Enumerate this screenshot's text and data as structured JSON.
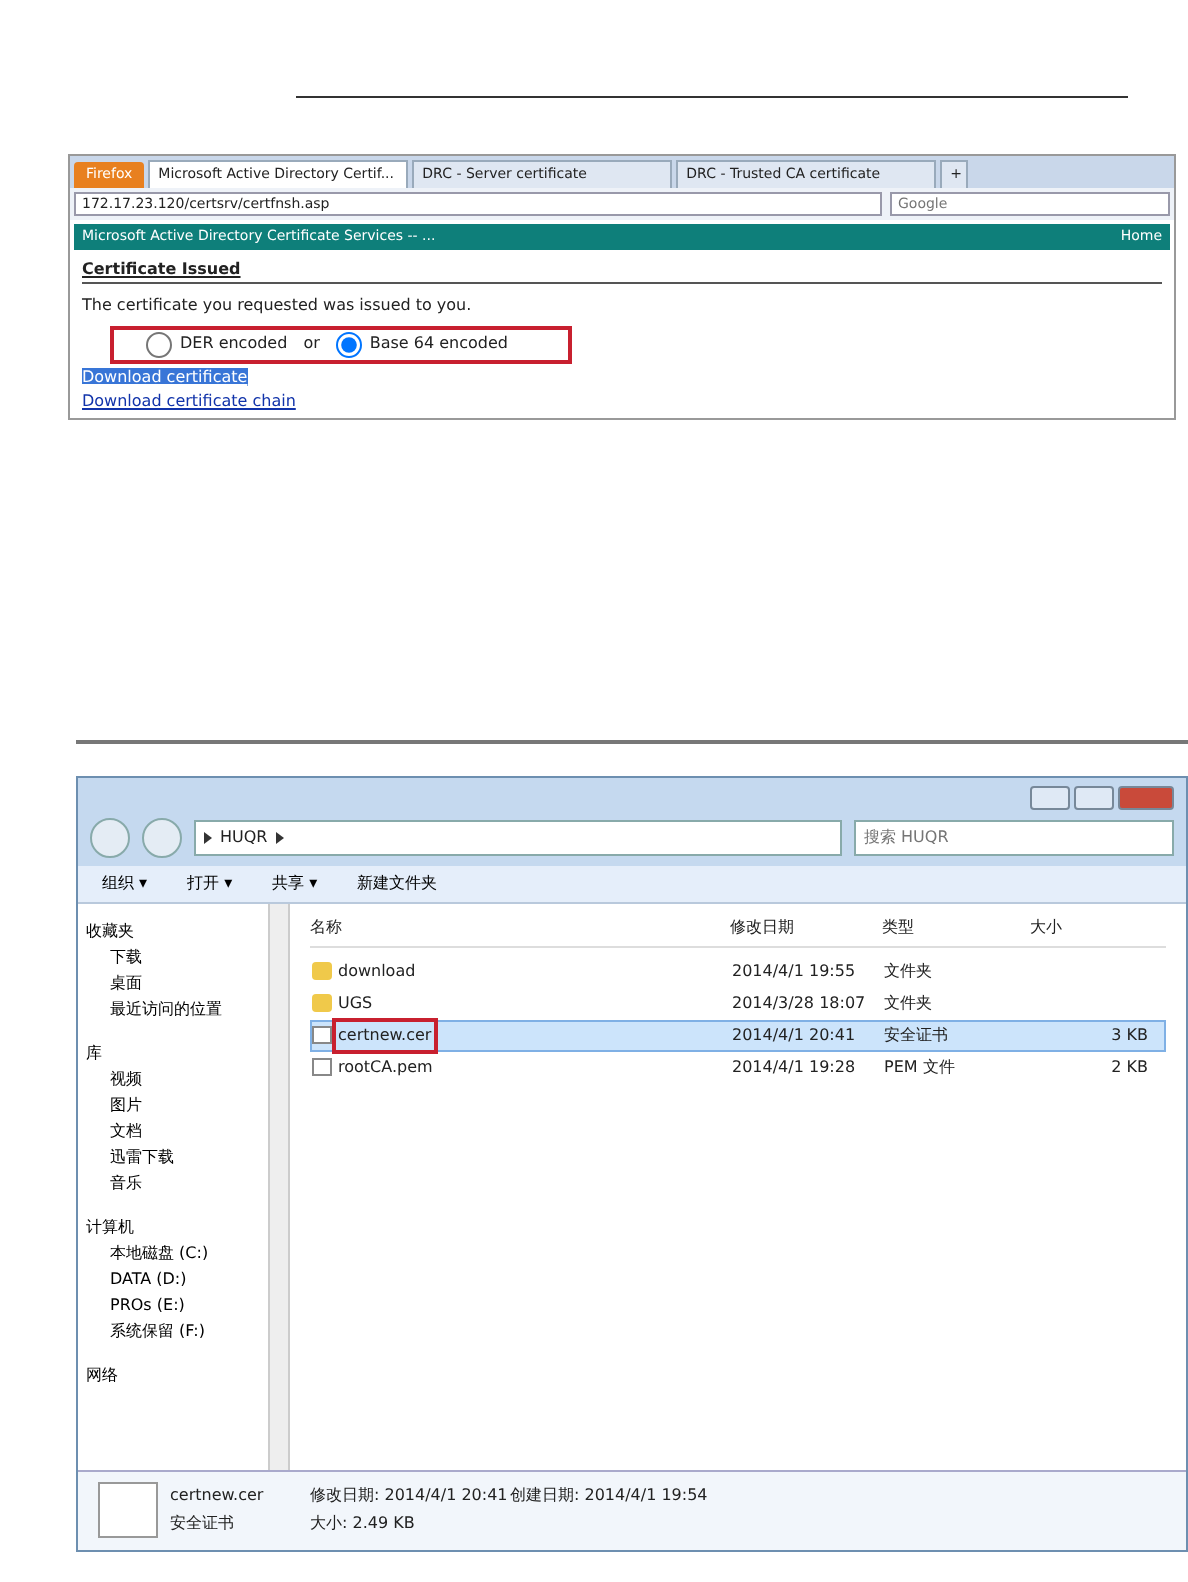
{
  "browser": {
    "menu_button": "Firefox",
    "tabs": [
      {
        "label": "Microsoft Active Directory Certif...",
        "selected": true
      },
      {
        "label": "DRC - Server certificate",
        "selected": false
      },
      {
        "label": "DRC - Trusted CA certificate",
        "selected": false
      }
    ],
    "new_tab": "+",
    "address": "172.17.23.120/certsrv/certfnsh.asp",
    "search_placeholder": "Google",
    "header": {
      "title": "Microsoft Active Directory Certificate Services -- ...",
      "home": "Home"
    },
    "heading": "Certificate Issued",
    "message": "The certificate you requested was issued to you.",
    "encodings": [
      {
        "label": "DER encoded",
        "selected": false
      },
      {
        "label": "Base 64 encoded",
        "selected": true
      }
    ],
    "encoding_separator": "or",
    "links": [
      "Download certificate",
      "Download certificate chain"
    ]
  },
  "explorer": {
    "path": "HUQR",
    "search_placeholder": "搜索 HUQR",
    "toolbar": [
      "组织 ▾",
      "打开 ▾",
      "共享 ▾",
      "新建文件夹"
    ],
    "sidebar": [
      {
        "label": "收藏夹",
        "children": [
          {
            "label": "下载"
          },
          {
            "label": "桌面"
          },
          {
            "label": "最近访问的位置"
          }
        ]
      },
      {
        "label": "库",
        "children": [
          {
            "label": "视频"
          },
          {
            "label": "图片"
          },
          {
            "label": "文档"
          },
          {
            "label": "迅雷下载"
          },
          {
            "label": "音乐"
          }
        ]
      },
      {
        "label": "计算机",
        "children": [
          {
            "label": "本地磁盘 (C:)"
          },
          {
            "label": "DATA (D:)"
          },
          {
            "label": "PROs (E:)"
          },
          {
            "label": "系统保留 (F:)"
          }
        ]
      },
      {
        "label": "网络"
      }
    ],
    "columns": [
      "名称",
      "修改日期",
      "类型",
      "大小"
    ],
    "rows": [
      {
        "kind": "folder",
        "name": "download",
        "date": "2014/4/1 19:55",
        "type": "文件夹",
        "selected": false
      },
      {
        "kind": "folder",
        "name": "UGS",
        "date": "2014/3/28 18:07",
        "type": "文件夹",
        "selected": false
      },
      {
        "kind": "file",
        "name": "certnew.cer",
        "date": "2014/4/1 20:41",
        "type": "安全证书",
        "size": "3 KB",
        "selected": true
      },
      {
        "kind": "file",
        "name": "rootCA.pem",
        "date": "2014/4/1 19:28",
        "type": "PEM 文件",
        "size": "2 KB",
        "selected": false
      }
    ],
    "details": {
      "name": "certnew.cer",
      "modified": "修改日期: 2014/4/1 20:41",
      "created": "创建日期: 2014/4/1 19:54",
      "type": "安全证书",
      "size": "大小: 2.49 KB"
    }
  }
}
